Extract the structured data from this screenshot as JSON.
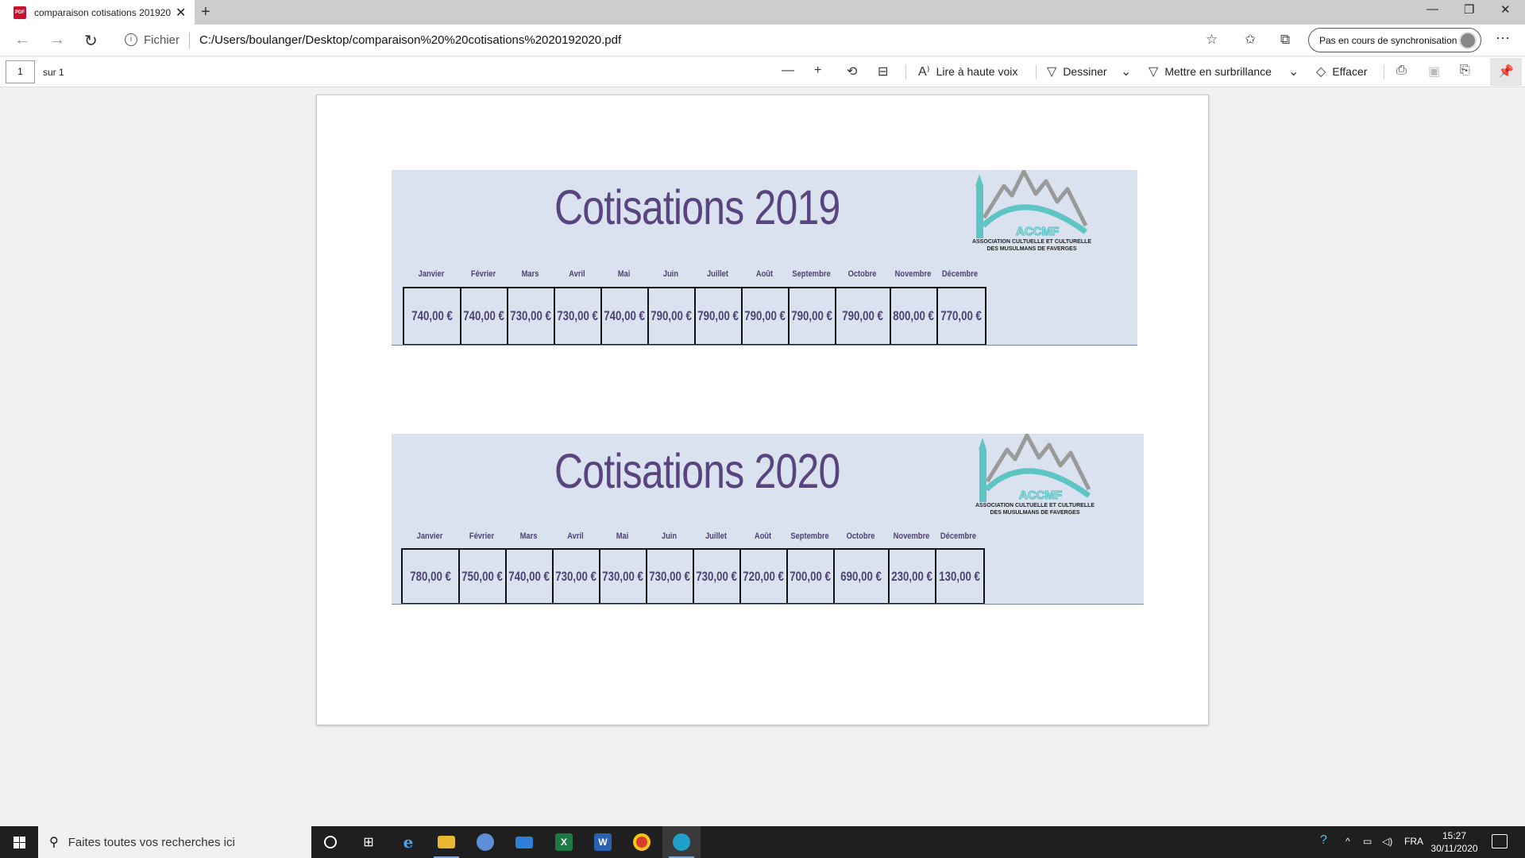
{
  "browser": {
    "tab_title": "comparaison cotisations 201920...",
    "tab_icon": "pdf-icon",
    "new_tab_label": "+",
    "site_label": "Fichier",
    "url": "C:/Users/boulanger/Desktop/comparaison%20%20cotisations%2020192020.pdf",
    "sync_label": "Pas en cours de synchronisation"
  },
  "pdf_toolbar": {
    "page_number": "1",
    "page_of": "sur 1",
    "read_aloud": "Lire à haute voix",
    "draw": "Dessiner",
    "highlight": "Mettre en surbrillance",
    "erase": "Effacer"
  },
  "document": {
    "cards": [
      {
        "title": "Cotisations  2019",
        "logo_text_line1": "ASSOCIATION CULTUELLE ET CULTURELLE",
        "logo_text_line2": "DES MUSULMANS DE FAVERGES",
        "logo_letters": "ACCMF",
        "months": [
          "Janvier",
          "Février",
          "Mars",
          "Avril",
          "Mai",
          "Juin",
          "Juillet",
          "Août",
          "Septembre",
          "Octobre",
          "Novembre",
          "Décembre"
        ],
        "values": [
          "740,00 €",
          "740,00 €",
          "730,00 €",
          "730,00 €",
          "740,00 €",
          "790,00 €",
          "790,00 €",
          "790,00 €",
          "790,00 €",
          "790,00 €",
          "800,00 €",
          "770,00 €"
        ]
      },
      {
        "title": "Cotisations  2020",
        "logo_text_line1": "ASSOCIATION CULTUELLE ET CULTURELLE",
        "logo_text_line2": "DES MUSULMANS DE FAVERGES",
        "logo_letters": "ACCMF",
        "months": [
          "Janvier",
          "Février",
          "Mars",
          "Avril",
          "Mai",
          "Juin",
          "Juillet",
          "Août",
          "Septembre",
          "Octobre",
          "Novembre",
          "Décembre"
        ],
        "values": [
          "780,00 €",
          "750,00 €",
          "740,00 €",
          "730,00 €",
          "730,00 €",
          "730,00 €",
          "730,00 €",
          "720,00 €",
          "700,00 €",
          "690,00 €",
          "230,00 €",
          "130,00 €"
        ]
      }
    ],
    "colors": {
      "card_bg": "#d9e2ee",
      "title_color": "#5a4480",
      "logo_teal": "#5fc4c4",
      "logo_gray": "#9a9a9a"
    }
  },
  "taskbar": {
    "search_placeholder": "Faites toutes vos recherches ici",
    "language": "FRA",
    "time": "15:27",
    "date": "30/11/2020"
  }
}
